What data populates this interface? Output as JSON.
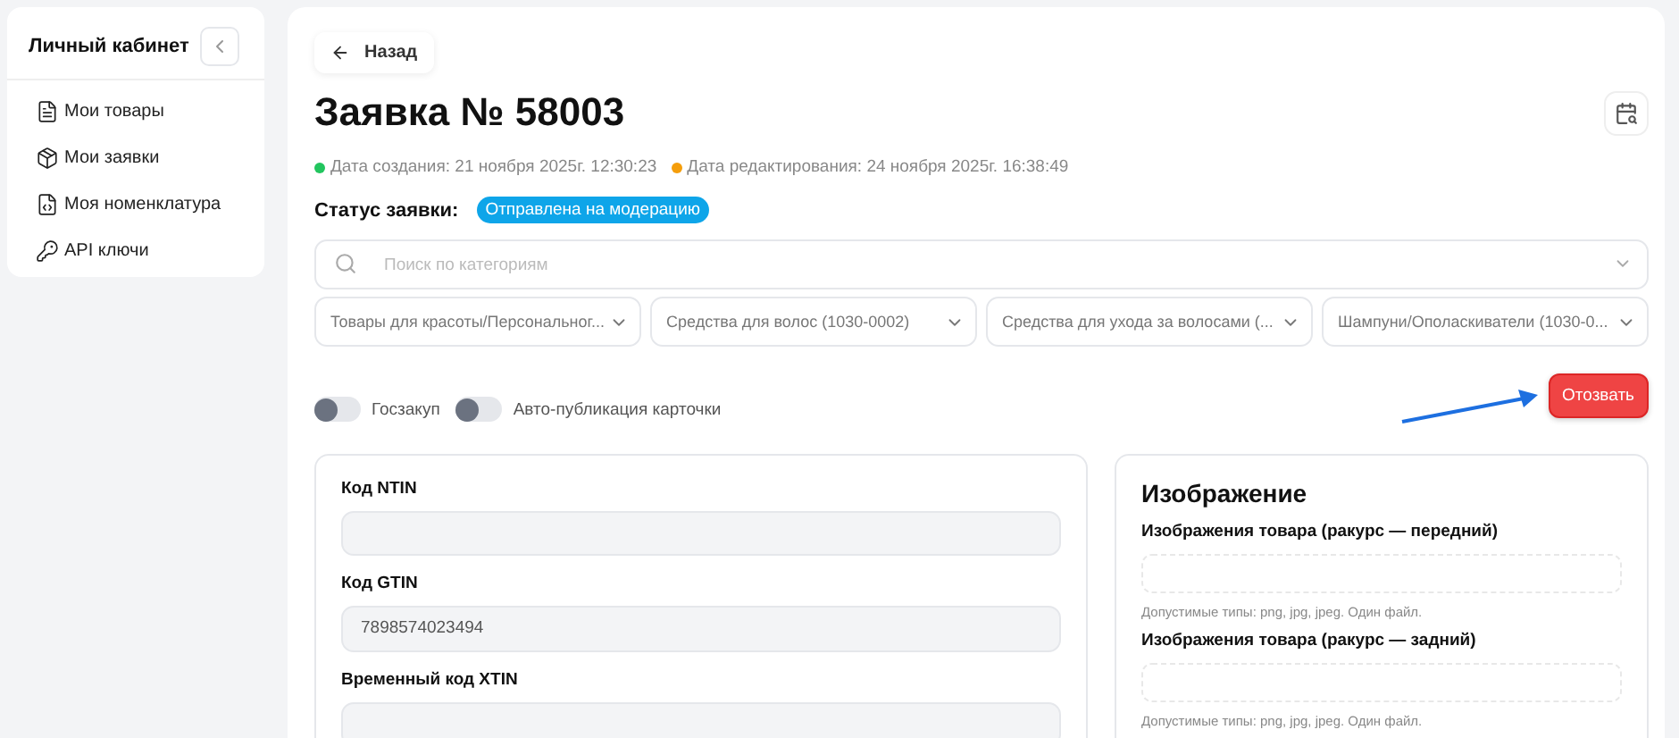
{
  "sidebar": {
    "title": "Личный кабинет",
    "items": [
      {
        "label": "Мои товары"
      },
      {
        "label": "Мои заявки"
      },
      {
        "label": "Моя номенклатура"
      },
      {
        "label": "API ключи"
      }
    ]
  },
  "back": "Назад",
  "title": "Заявка № 58003",
  "dates": [
    {
      "text": "Дата создания: 21 ноября 2025г. 12:30:23",
      "color": "#22c55e"
    },
    {
      "text": "Дата редактирования: 24 ноября 2025г. 16:38:49",
      "color": "#f59e0b"
    }
  ],
  "status": {
    "label": "Статус заявки:",
    "value": "Отправлена на модерацию"
  },
  "search": {
    "placeholder": "Поиск по категориям"
  },
  "categories": [
    "Товары для красоты/Персональног...",
    "Средства для волос (1030-0002)",
    "Средства для ухода за волосами (...",
    "Шампуни/Ополаскиватели (1030-0..."
  ],
  "toggles": [
    {
      "label": "Госзакуп",
      "on": false
    },
    {
      "label": "Авто-публикация карточки",
      "on": false
    }
  ],
  "revoke": "Отозвать",
  "codes": [
    {
      "label": "Код NTIN"
    },
    {
      "label": "Код GTIN",
      "value": "7898574023494"
    },
    {
      "label": "Временный код XTIN"
    }
  ],
  "images": {
    "title": "Изображение",
    "fields": [
      {
        "label": "Изображения товара (ракурс — передний)",
        "hint": "Допустимые типы: png, jpg, jpeg. Один файл."
      },
      {
        "label": "Изображения товара (ракурс — задний)",
        "hint": "Допустимые типы: png, jpg, jpeg. Один файл."
      }
    ]
  }
}
